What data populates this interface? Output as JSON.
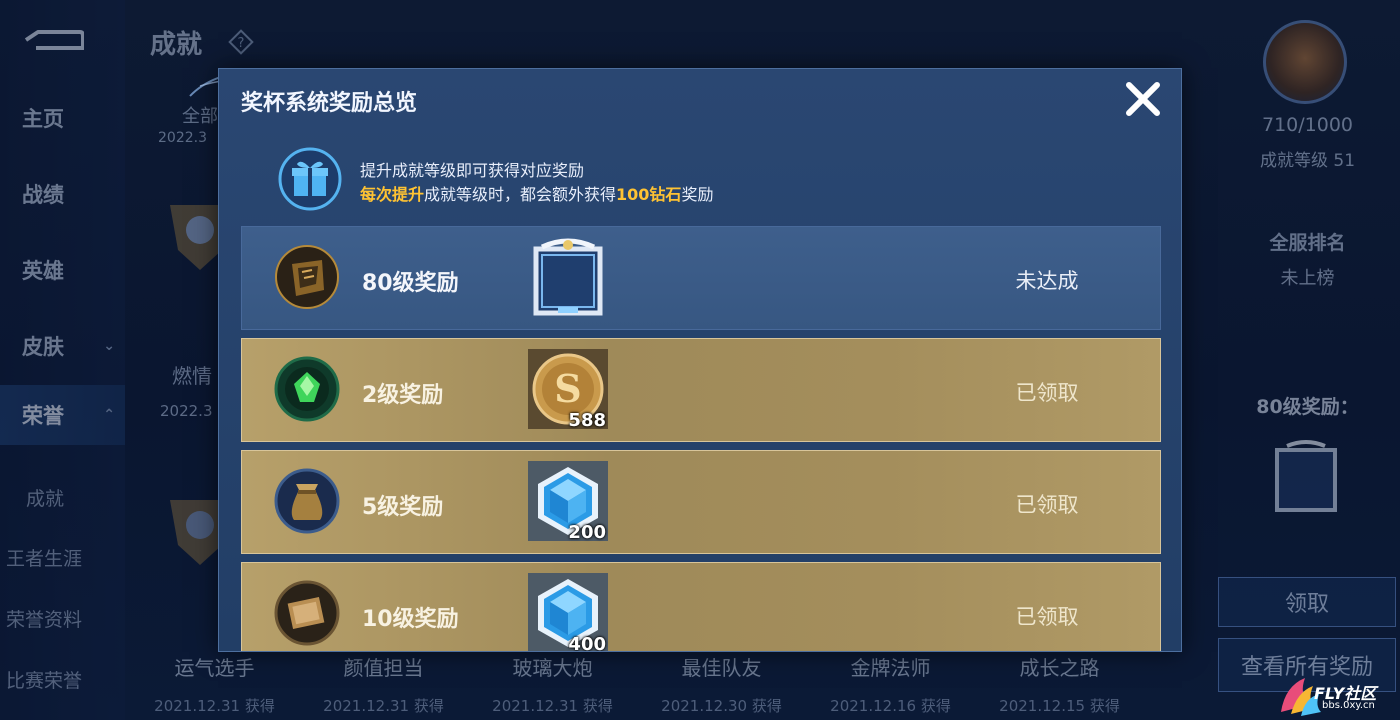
{
  "sidebar": {
    "items": [
      {
        "label": "主页"
      },
      {
        "label": "战绩"
      },
      {
        "label": "英雄"
      },
      {
        "label": "皮肤"
      },
      {
        "label": "荣誉"
      }
    ],
    "subitems": [
      {
        "label": "成就"
      },
      {
        "label": "王者生涯"
      },
      {
        "label": "荣誉资料"
      },
      {
        "label": "比赛荣誉"
      }
    ]
  },
  "page": {
    "title": "成就",
    "bg_fragment_1": "全部",
    "bg_date_1": "2022.3",
    "bg_fragment_2": "燃情",
    "bg_date_2": "2022.3"
  },
  "right_panel": {
    "progress": "710/1000",
    "level": "成就等级 51",
    "rank_label": "全服排名",
    "rank_value": "未上榜",
    "reward_label": "80级奖励：",
    "claim_button": "领取",
    "view_all_button": "查看所有奖励"
  },
  "bottom_achievements": [
    {
      "name": "运气选手",
      "date": "2021.12.31 获得"
    },
    {
      "name": "颜值担当",
      "date": "2021.12.31 获得"
    },
    {
      "name": "玻璃大炮",
      "date": "2021.12.31 获得"
    },
    {
      "name": "最佳队友",
      "date": "2021.12.30 获得"
    },
    {
      "name": "金牌法师",
      "date": "2021.12.16 获得"
    },
    {
      "name": "成长之路",
      "date": "2021.12.15 获得"
    }
  ],
  "modal": {
    "title": "奖杯系统奖励总览",
    "info_line1": "提升成就等级即可获得对应奖励",
    "info_line2_hl1": "每次提升",
    "info_line2_mid": "成就等级时，都会额外获得",
    "info_line2_hl2": "100钻石",
    "info_line2_end": "奖励",
    "rows": [
      {
        "label": "80级奖励",
        "status": "未达成",
        "reward_icon": "avatar-frame-icon",
        "count": "",
        "style": "blue"
      },
      {
        "label": "2级奖励",
        "status": "已领取",
        "reward_icon": "gold-coin-icon",
        "count": "588",
        "style": "gold"
      },
      {
        "label": "5级奖励",
        "status": "已领取",
        "reward_icon": "diamond-icon",
        "count": "200",
        "style": "gold"
      },
      {
        "label": "10级奖励",
        "status": "已领取",
        "reward_icon": "diamond-icon",
        "count": "400",
        "style": "gold"
      }
    ]
  },
  "watermark": {
    "brand": "FLY社区",
    "url": "bbs.0xy.cn"
  },
  "colors": {
    "highlight": "#ffc333",
    "modal_bg": "#2a4772",
    "row_blue": "#3e5f8c",
    "row_gold": "#b7a06a"
  }
}
